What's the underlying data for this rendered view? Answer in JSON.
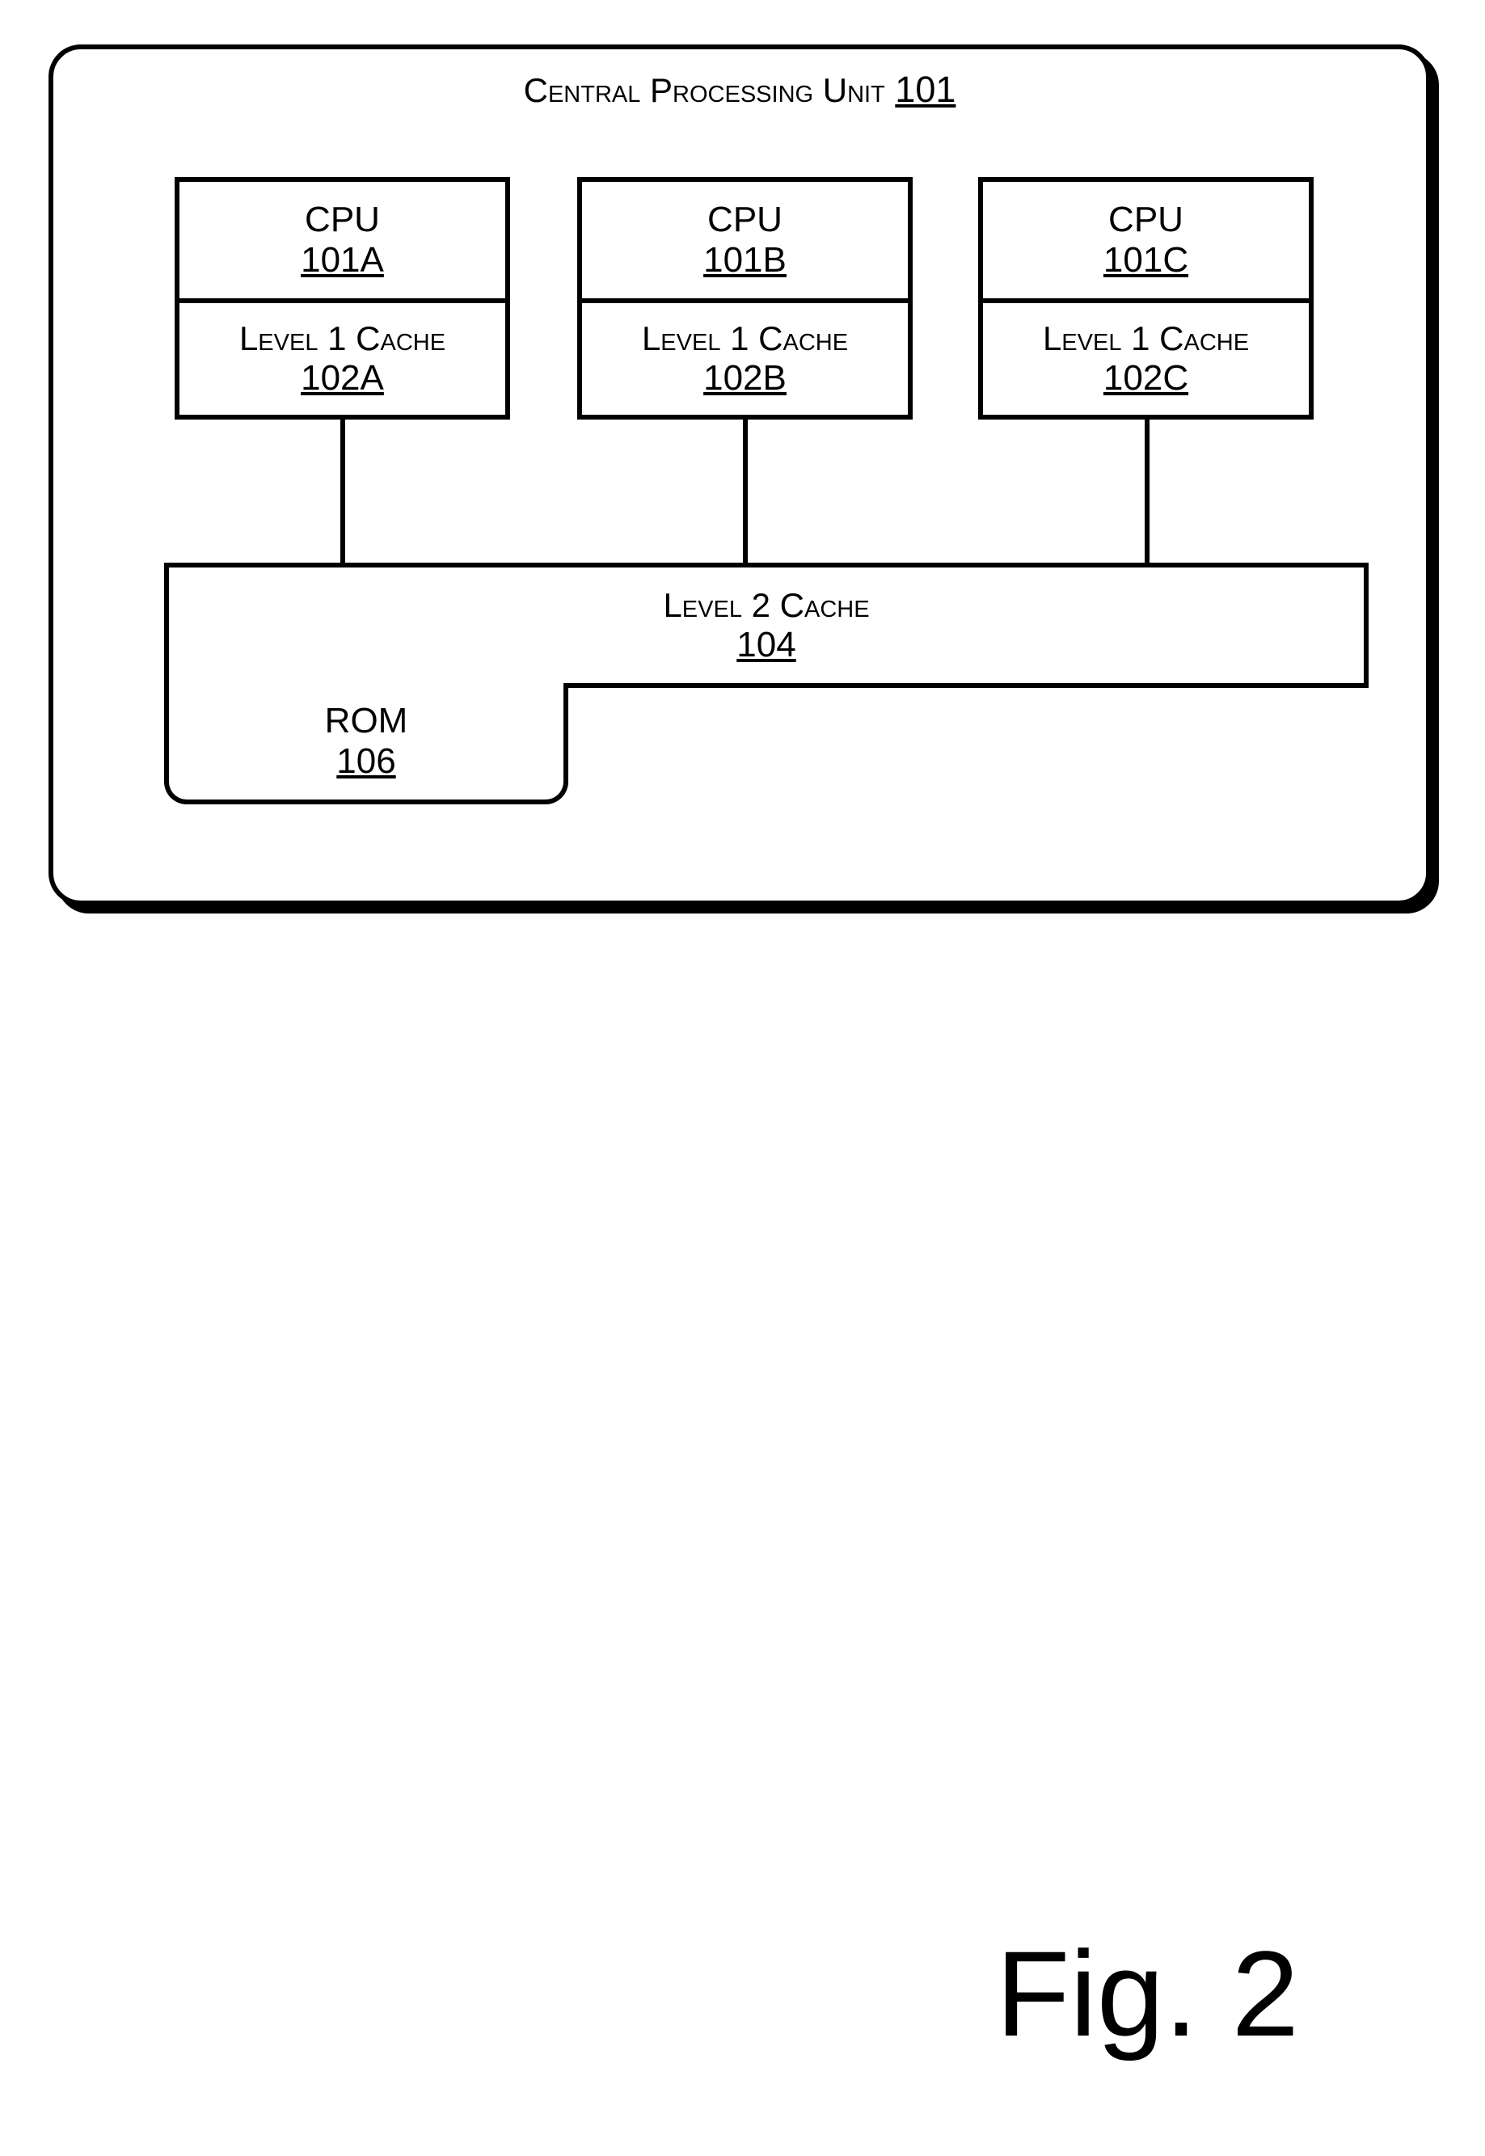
{
  "figure_label": "Fig. 2",
  "outer": {
    "title_text": "Central Processing Unit",
    "title_num": "101"
  },
  "cpus": [
    {
      "label": "CPU",
      "num": "101A",
      "cache_label": "Level 1 Cache",
      "cache_num": "102A"
    },
    {
      "label": "CPU",
      "num": "101B",
      "cache_label": "Level 1 Cache",
      "cache_num": "102B"
    },
    {
      "label": "CPU",
      "num": "101C",
      "cache_label": "Level 1 Cache",
      "cache_num": "102C"
    }
  ],
  "l2": {
    "label": "Level 2 Cache",
    "num": "104"
  },
  "rom": {
    "label": "ROM",
    "num": "106"
  }
}
